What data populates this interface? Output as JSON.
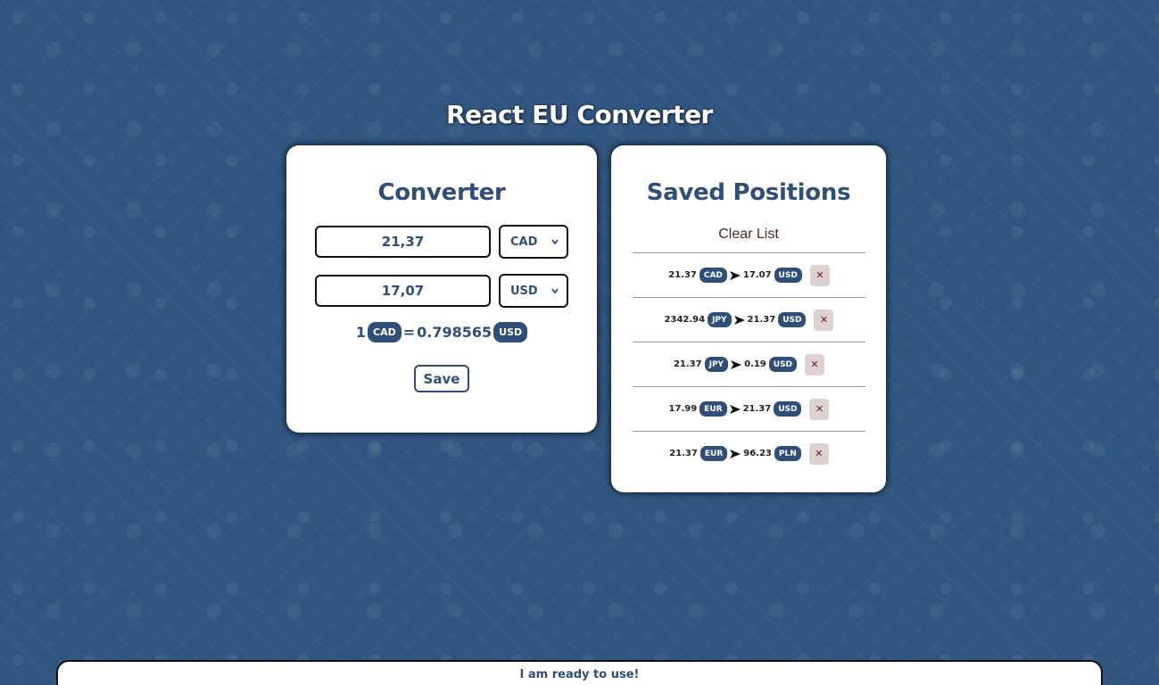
{
  "app": {
    "title": "React EU Converter"
  },
  "converter": {
    "title": "Converter",
    "from": {
      "amount": "21,37",
      "currency": "CAD"
    },
    "to": {
      "amount": "17,07",
      "currency": "USD"
    },
    "rate": {
      "base_amount": "1",
      "base_currency": "CAD",
      "equals": "=",
      "value": "0.798565",
      "target_currency": "USD"
    },
    "save_label": "Save"
  },
  "saved": {
    "title": "Saved Positions",
    "clear_label": "Clear List",
    "items": [
      {
        "from_amount": "21.37",
        "from_currency": "CAD",
        "to_amount": "17.07",
        "to_currency": "USD",
        "delete_label": "✕"
      },
      {
        "from_amount": "2342.94",
        "from_currency": "JPY",
        "to_amount": "21.37",
        "to_currency": "USD",
        "delete_label": "✕"
      },
      {
        "from_amount": "21.37",
        "from_currency": "JPY",
        "to_amount": "0.19",
        "to_currency": "USD",
        "delete_label": "✕"
      },
      {
        "from_amount": "17.99",
        "from_currency": "EUR",
        "to_amount": "21.37",
        "to_currency": "USD",
        "delete_label": "✕"
      },
      {
        "from_amount": "21.37",
        "from_currency": "EUR",
        "to_amount": "96.23",
        "to_currency": "PLN",
        "delete_label": "✕"
      }
    ]
  },
  "status": {
    "text": "I am ready to use!"
  },
  "icons": {
    "arrow": "arrow-right-icon",
    "chevron": "chevron-down-icon",
    "delete": "close-icon"
  },
  "colors": {
    "background": "#30557f",
    "accent": "#2f4f79",
    "delete_bg": "#ddd2d2",
    "card": "#ffffff"
  }
}
